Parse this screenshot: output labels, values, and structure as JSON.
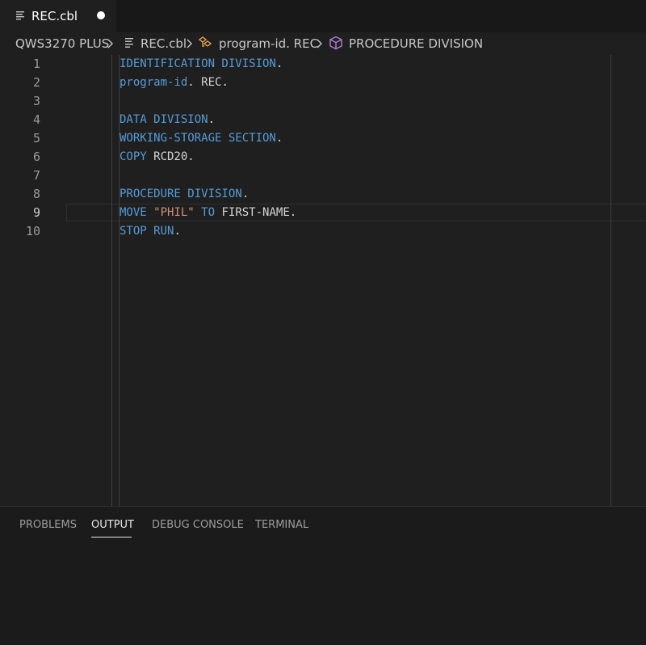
{
  "tab": {
    "label": "REC.cbl",
    "icon": "file-lines-icon",
    "unsaved": true
  },
  "breadcrumb": {
    "root": "QWS3270 PLUS",
    "file": "REC.cbl",
    "symbol": "program-id. REC",
    "section": "PROCEDURE DIVISION",
    "icons": [
      "chevron-right-icon",
      "file-lines-icon",
      "symbol-key-icon",
      "cube-icon"
    ]
  },
  "editor": {
    "active_line": 9,
    "lines": [
      {
        "num": "1",
        "parts": [
          {
            "t": "IDENTIFICATION DIVISION",
            "k": "kw"
          },
          {
            "t": ".",
            "k": "plain"
          }
        ]
      },
      {
        "num": "2",
        "parts": [
          {
            "t": "program-id",
            "k": "kw"
          },
          {
            "t": ". REC.",
            "k": "plain"
          }
        ]
      },
      {
        "num": "3",
        "parts": []
      },
      {
        "num": "4",
        "parts": [
          {
            "t": "DATA DIVISION",
            "k": "kw"
          },
          {
            "t": ".",
            "k": "plain"
          }
        ]
      },
      {
        "num": "5",
        "parts": [
          {
            "t": "WORKING-STORAGE SECTION",
            "k": "kw"
          },
          {
            "t": ".",
            "k": "plain"
          }
        ]
      },
      {
        "num": "6",
        "parts": [
          {
            "t": "COPY",
            "k": "kw"
          },
          {
            "t": " RCD20.",
            "k": "plain"
          }
        ]
      },
      {
        "num": "7",
        "parts": []
      },
      {
        "num": "8",
        "parts": [
          {
            "t": "PROCEDURE DIVISION",
            "k": "kw"
          },
          {
            "t": ".",
            "k": "plain"
          }
        ]
      },
      {
        "num": "9",
        "parts": [
          {
            "t": "MOVE",
            "k": "kw"
          },
          {
            "t": " ",
            "k": "plain"
          },
          {
            "t": "\"PHIL\"",
            "k": "str"
          },
          {
            "t": " ",
            "k": "plain"
          },
          {
            "t": "TO",
            "k": "kw"
          },
          {
            "t": " FIRST-NAME.",
            "k": "plain"
          }
        ]
      },
      {
        "num": "10",
        "parts": [
          {
            "t": "STOP RUN",
            "k": "kw"
          },
          {
            "t": ".",
            "k": "plain"
          }
        ]
      }
    ]
  },
  "panel": {
    "tabs": [
      {
        "label": "PROBLEMS",
        "active": false
      },
      {
        "label": "OUTPUT",
        "active": true
      },
      {
        "label": "DEBUG CONSOLE",
        "active": false
      },
      {
        "label": "TERMINAL",
        "active": false
      }
    ]
  },
  "colors": {
    "keyword": "#569cd6",
    "string": "#ce9178",
    "background": "#1f1f1f",
    "symbol_icon": "#e8a045",
    "cube_icon": "#b180d7"
  }
}
